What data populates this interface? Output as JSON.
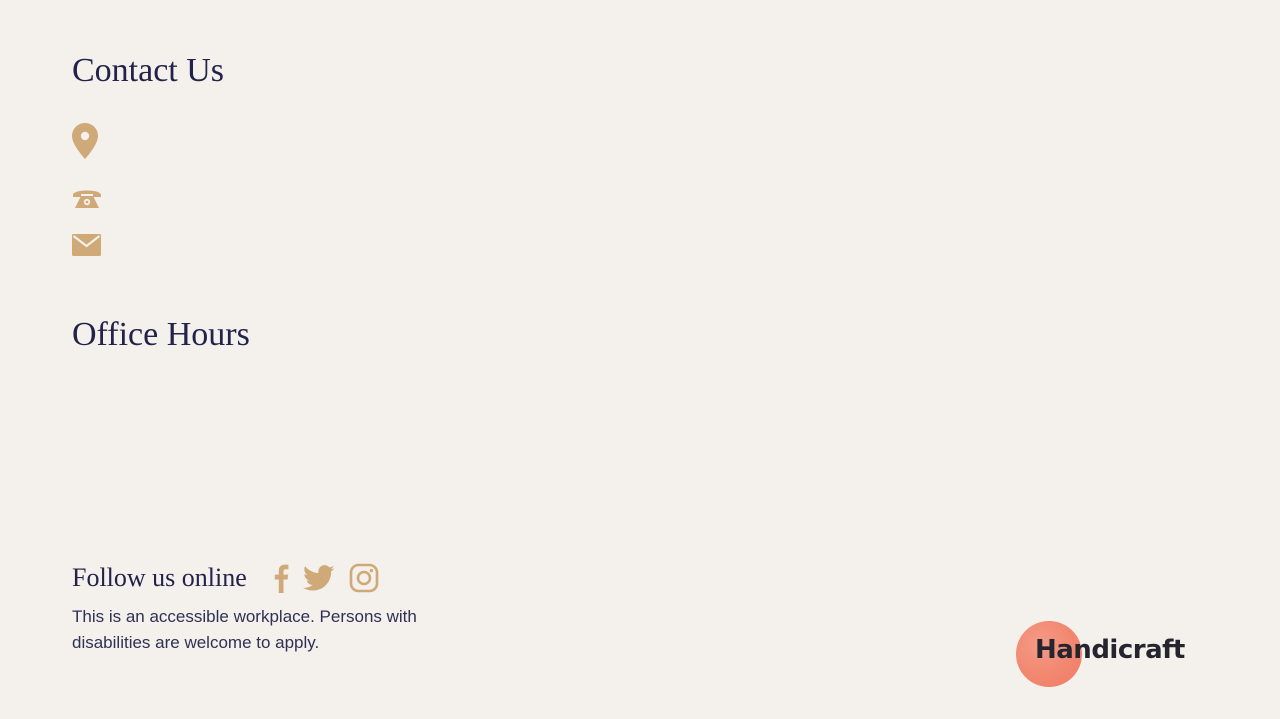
{
  "contact": {
    "title": "Contact Us",
    "icons": [
      "location-pin-icon",
      "telephone-icon",
      "envelope-icon"
    ]
  },
  "office_hours": {
    "title": "Office Hours"
  },
  "follow": {
    "label": "Follow us online",
    "socials": [
      "facebook-icon",
      "twitter-icon",
      "instagram-icon"
    ]
  },
  "accessibility_note": "This is an accessible workplace. Persons with disabilities are welcome to apply.",
  "brand": {
    "name": "Handicraft"
  },
  "colors": {
    "background": "#f4f0eb",
    "heading": "#22224a",
    "icon_gold": "#cfa977",
    "logo_circle": "#f2876f"
  }
}
